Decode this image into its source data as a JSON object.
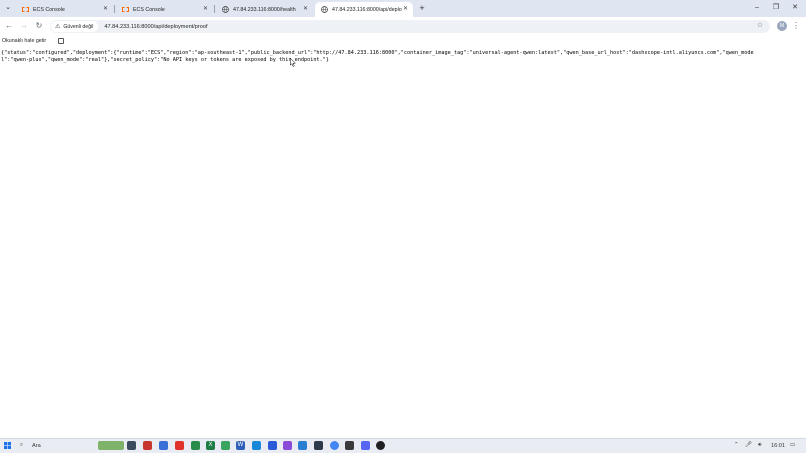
{
  "tabs": [
    {
      "title": "ECS Console",
      "favicon": "alibaba-cloud-icon",
      "active": false
    },
    {
      "title": "ECS Console",
      "favicon": "alibaba-cloud-icon",
      "active": false
    },
    {
      "title": "47.84.233.116:8000/health",
      "favicon": "globe-icon",
      "active": false
    },
    {
      "title": "47.84.233.116:8000/api/deploy...",
      "favicon": "globe-icon",
      "active": true
    }
  ],
  "omnibox": {
    "security_label": "Güvenli değil",
    "url": "47.84.233.116:8000/api/deployment/proof"
  },
  "reader_bar": {
    "label": "Okunaklı hale getir"
  },
  "page": {
    "json_text": "{\"status\":\"configured\",\"deployment\":{\"runtime\":\"ECS\",\"region\":\"ap-southeast-1\",\"public_backend_url\":\"http://47.84.233.116:8000\",\"container_image_tag\":\"universal-agent-qwen:latest\",\"qwen_base_url_host\":\"dashscope-intl.aliyuncs.com\",\"qwen_model\":\"qwen-plus\",\"qwen_mode\":\"real\"},\"secret_policy\":\"No API keys or tokens are exposed by this endpoint.\"}"
  },
  "profile": {
    "initial": "M"
  },
  "taskbar": {
    "search_label": "Ara",
    "clock": "16:01"
  },
  "colors": {
    "tabstrip_bg": "#dfe6f1",
    "omnibox_bg": "#eef1f5",
    "taskbar_bg": "#e9edf3"
  }
}
